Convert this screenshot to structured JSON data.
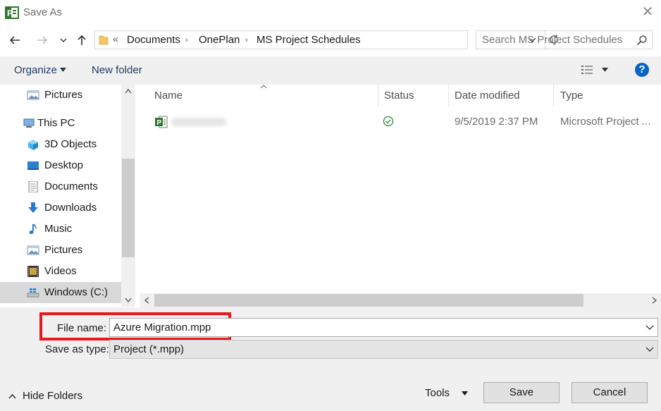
{
  "window": {
    "title": "Save As",
    "close_glyph": "✕"
  },
  "nav": {
    "breadcrumb_prefix": "«",
    "breadcrumb": [
      "Documents",
      "OnePlan",
      "MS Project Schedules"
    ],
    "search_placeholder": "Search MS Project Schedules"
  },
  "toolbar": {
    "organize_label": "Organize",
    "new_folder_label": "New folder",
    "help_glyph": "?"
  },
  "sidebar": {
    "items": [
      {
        "label": "Pictures",
        "icon": "pictures-icon"
      },
      {
        "label": "This PC",
        "icon": "this-pc-icon"
      },
      {
        "label": "3D Objects",
        "icon": "3d-objects-icon"
      },
      {
        "label": "Desktop",
        "icon": "desktop-icon"
      },
      {
        "label": "Documents",
        "icon": "documents-icon"
      },
      {
        "label": "Downloads",
        "icon": "downloads-icon"
      },
      {
        "label": "Music",
        "icon": "music-icon"
      },
      {
        "label": "Pictures",
        "icon": "pictures-icon"
      },
      {
        "label": "Videos",
        "icon": "videos-icon"
      },
      {
        "label": "Windows (C:)",
        "icon": "drive-icon"
      }
    ]
  },
  "filelist": {
    "columns": [
      "Name",
      "Status",
      "Date modified",
      "Type"
    ],
    "rows": [
      {
        "name": "",
        "status_icon": "sync-ok-icon",
        "date": "9/5/2019 2:37 PM",
        "type": "Microsoft Project ..."
      }
    ]
  },
  "form": {
    "filename_label": "File name:",
    "filename_value": "Azure Migration.mpp",
    "type_label": "Save as type:",
    "type_value": "Project (*.mpp)",
    "highlight_color": "#e8191d"
  },
  "footer": {
    "hide_folders_label": "Hide Folders",
    "tools_label": "Tools",
    "save_label": "Save",
    "cancel_label": "Cancel"
  },
  "colors": {
    "accent": "#0078d7",
    "project_green": "#31752f"
  }
}
